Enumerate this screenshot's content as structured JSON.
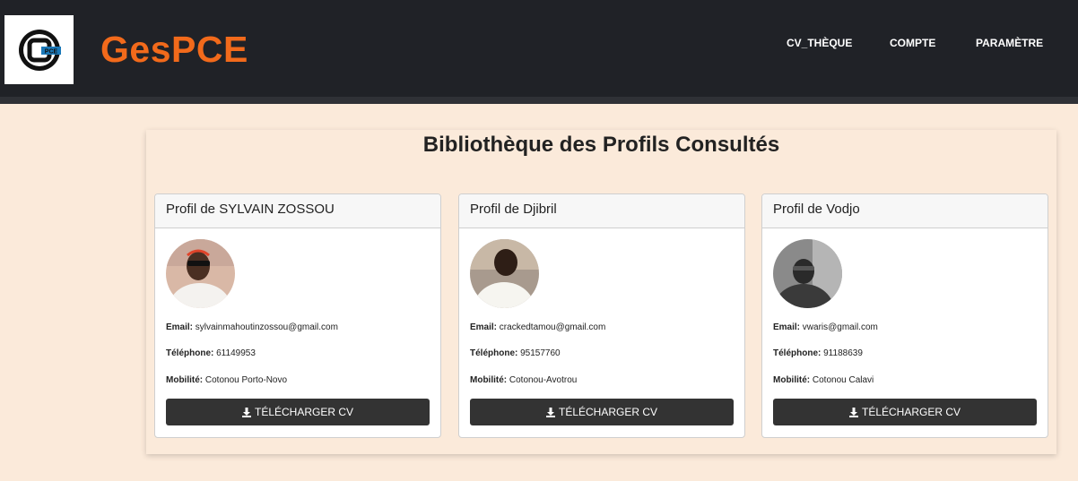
{
  "brand": {
    "name": "GesPCE",
    "logo_text": "PCE"
  },
  "nav": {
    "items": [
      "CV_THÈQUE",
      "COMPTE",
      "PARAMÈTRE"
    ]
  },
  "page": {
    "title": "Bibliothèque des Profils Consultés"
  },
  "labels": {
    "email": "Email:",
    "phone": "Téléphone:",
    "mobility": "Mobilité:",
    "download": "TÉLÉCHARGER CV",
    "download_icon": "download-icon"
  },
  "profiles": [
    {
      "header": "Profil de SYLVAIN ZOSSOU",
      "email": "sylvainmahoutinzossou@gmail.com",
      "phone": "61149953",
      "mobility": "Cotonou Porto-Novo"
    },
    {
      "header": "Profil de Djibril",
      "email": "crackedtamou@gmail.com",
      "phone": "95157760",
      "mobility": "Cotonou-Avotrou"
    },
    {
      "header": "Profil de Vodjo",
      "email": "vwaris@gmail.com",
      "phone": "91188639",
      "mobility": "Cotonou Calavi"
    }
  ],
  "colors": {
    "nav_bg": "#202227",
    "brand": "#f26a1b",
    "page_bg": "#fbeada",
    "button_bg": "#333333"
  }
}
